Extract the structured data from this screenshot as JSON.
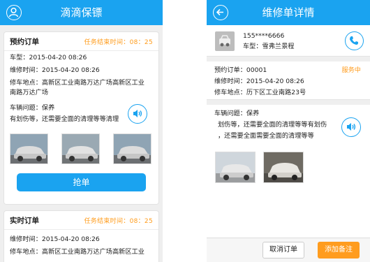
{
  "left": {
    "title": "滴滴保镖",
    "order1": {
      "type": "预约订单",
      "timer": "任务结束时间：08：25",
      "car_model": "车型：2015-04-20 08:26",
      "repair_time": "维修时间：2015-04-20 08:26",
      "repair_location": "修车地点：高新区工业南路万达广场高新区工业南路万达广场",
      "issue": "车辆问题：保养",
      "desc": "有划伤等，还需要全面的清理等等清理",
      "grab_label": "抢单"
    },
    "order2": {
      "type": "实时订单",
      "timer": "任务结束时间：08：25",
      "repair_time": "维修时间：2015-04-20 08:26",
      "repair_location": "修车地点：高新区工业南路万达广场高新区工业"
    }
  },
  "right": {
    "title": "维修单详情",
    "phone_number": "155****6666",
    "car_model": "车型：雪弗兰景程",
    "order_no": "预约订单：00001",
    "status": "服务中",
    "repair_time": "维修时间：2015-04-20 08:26",
    "repair_location": "修车地点：历下区工业南路23号",
    "issue": "车辆问题：保养",
    "desc_line1": "划伤等，还需要全面的清理等等有划伤",
    "desc_line2": "，还需要全面需要全面的清理等等",
    "cancel_label": "取消订单",
    "add_note_label": "添加备注"
  },
  "colors": {
    "accent": "#1aa3f0",
    "orange": "#ff9c1e"
  },
  "icons": [
    "user-icon",
    "back-arrow-icon",
    "speaker-icon",
    "phone-icon",
    "car-avatar-icon"
  ]
}
